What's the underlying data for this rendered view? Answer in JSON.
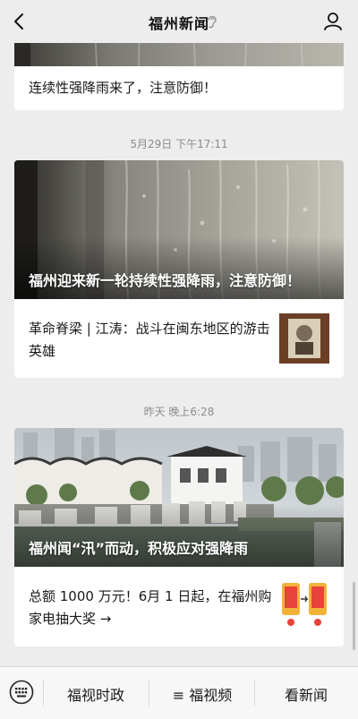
{
  "header": {
    "title": "福州新闻",
    "back_icon": "chevron-left-icon",
    "ear_icon": "ear-icon",
    "profile_icon": "user-icon"
  },
  "feed": {
    "card0": {
      "text": "连续性强降雨来了，注意防御！"
    },
    "timestamp1": "5月29日 下午17:11",
    "card1": {
      "headline": "福州迎来新一轮持续性强降雨，注意防御！",
      "sub_text_line1": "革命脊梁 | 江涛：战斗在闽东地区的游击",
      "sub_text_line2": "英雄"
    },
    "timestamp2": "昨天 晚上6:28",
    "card2": {
      "headline": "福州闻“汛”而动，积极应对强降雨",
      "sub_text_line1": "总额 1000 万元！6月 1 日起，在福州购",
      "sub_text_line2": "家电抽大奖 →"
    }
  },
  "bottom_bar": {
    "keyboard_icon": "keyboard-icon",
    "menu1": "福视时政",
    "menu2": "≡ 福视频",
    "menu3": "看新闻"
  }
}
